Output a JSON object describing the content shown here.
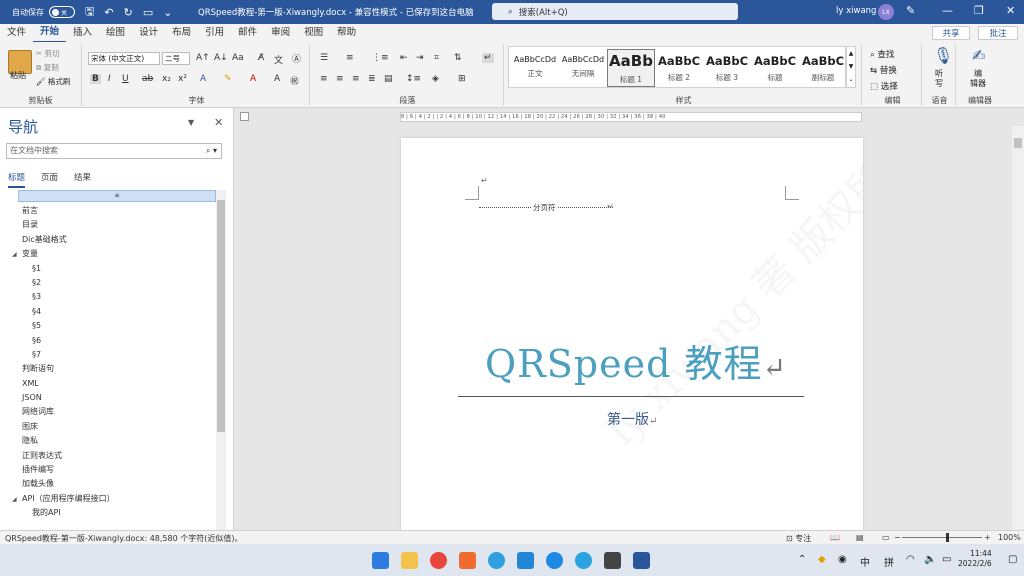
{
  "titlebar": {
    "autosave_label": "自动保存",
    "autosave_state": "关",
    "doc_title": "QRSpeed教程-第一版-Xiwangly.docx  -  兼容性模式  -  已保存到这台电脑",
    "search_placeholder": "搜索(Alt+Q)",
    "user_name": "ly xiwang",
    "avatar_initials": "LX"
  },
  "menu": {
    "items": [
      "文件",
      "开始",
      "插入",
      "绘图",
      "设计",
      "布局",
      "引用",
      "邮件",
      "审阅",
      "视图",
      "帮助"
    ],
    "active": "开始",
    "share_label": "共享",
    "comment_label": "批注"
  },
  "ribbon": {
    "clipboard": {
      "paste": "粘贴",
      "cut": "剪切",
      "copy": "复制",
      "format_painter": "格式刷",
      "label": "剪贴板"
    },
    "font": {
      "family": "宋体 (中文正文)",
      "size": "二号",
      "label": "字体"
    },
    "paragraph": {
      "label": "段落"
    },
    "styles": {
      "label": "样式",
      "items": [
        {
          "sample": "AaBbCcDd",
          "name": "正文"
        },
        {
          "sample": "AaBbCcDd",
          "name": "无间隔"
        },
        {
          "sample": "AaBb",
          "name": "标题 1"
        },
        {
          "sample": "AaBbC",
          "name": "标题 2"
        },
        {
          "sample": "AaBbC",
          "name": "标题 3"
        },
        {
          "sample": "AaBbC",
          "name": "标题"
        },
        {
          "sample": "AaBbC",
          "name": "副标题"
        }
      ]
    },
    "editing": {
      "find": "查找",
      "replace": "替换",
      "select": "选择",
      "label": "编辑"
    },
    "voice": {
      "dictate": "听\n写",
      "label": "语音"
    },
    "editor": {
      "name": "编\n辑器",
      "label": "编辑器"
    }
  },
  "nav": {
    "title": "导航",
    "search_placeholder": "在文档中搜索",
    "tabs": [
      "标题",
      "页面",
      "结果"
    ],
    "active_tab": "标题",
    "items": [
      {
        "label": "前言",
        "level": 1
      },
      {
        "label": "目录",
        "level": 1
      },
      {
        "label": "Dic基础格式",
        "level": 1
      },
      {
        "label": "变量",
        "level": 1,
        "expanded": true
      },
      {
        "label": "§1",
        "level": 2
      },
      {
        "label": "§2",
        "level": 2
      },
      {
        "label": "§3",
        "level": 2
      },
      {
        "label": "§4",
        "level": 2
      },
      {
        "label": "§5",
        "level": 2
      },
      {
        "label": "§6",
        "level": 2
      },
      {
        "label": "§7",
        "level": 2
      },
      {
        "label": "判断语句",
        "level": 1
      },
      {
        "label": "XML",
        "level": 1
      },
      {
        "label": "JSON",
        "level": 1
      },
      {
        "label": "网络词库",
        "level": 1
      },
      {
        "label": "图床",
        "level": 1
      },
      {
        "label": "隐私",
        "level": 1
      },
      {
        "label": "正则表达式",
        "level": 1
      },
      {
        "label": "插件编写",
        "level": 1
      },
      {
        "label": "加载头像",
        "level": 1
      },
      {
        "label": "API（应用程序编程接口）",
        "level": 1,
        "expanded": true
      },
      {
        "label": "我的API",
        "level": 2
      }
    ]
  },
  "ruler": {
    "text": "8 | 6 | 4 | 2 |  | 2 | 4 | 6 | 8 | 10 | 12 | 14 | 16 | 18 | 20 | 22 | 24 | 26 | 28 | 30 | 32 | 34 | 36 | 38 | 40"
  },
  "document": {
    "page_break_label": "分页符",
    "title": "QRSpeed 教程",
    "subtitle": "第一版",
    "watermark": "ly xiwang 著 版权所有",
    "paragraph_mark": "↵"
  },
  "status": {
    "text": "QRSpeed教程-第一版-Xiwangly.docx: 48,580 个字符(近似值)。",
    "focus": "专注",
    "zoom": "100%"
  },
  "taskbar": {
    "tray_ime": "中",
    "tray_layout": "拼",
    "time": "11:44",
    "date": "2022/2/6"
  },
  "colors": {
    "title_bar": "#2b579a",
    "title_text": "#4b9fbf",
    "subtitle_text": "#3a5a8c"
  }
}
